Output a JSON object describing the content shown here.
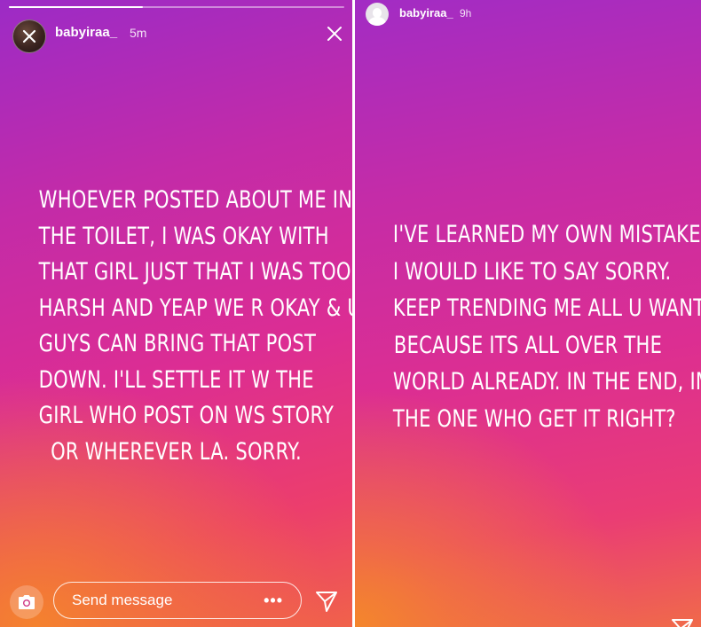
{
  "left_story": {
    "username": "babyiraa_",
    "time": "5m",
    "progress": 0.4,
    "text_lines": [
      "WHOEVER POSTED ABOUT ME IN",
      "THE TOILET, I WAS OKAY WITH",
      "THAT GIRL JUST THAT I WAS TOO",
      "HARSH AND YEAP WE R OKAY & U",
      "GUYS CAN BRING THAT POST",
      "DOWN. I'LL SETTLE IT W THE",
      "GIRL WHO POST ON WS STORY",
      "OR WHEREVER LA. SORRY."
    ],
    "message_placeholder": "Send message",
    "more_label": "•••"
  },
  "right_story": {
    "username": "babyiraa_",
    "time": "9h",
    "text_lines": [
      "I'VE LEARNED MY OWN MISTAKES,",
      "I WOULD LIKE TO SAY SORRY.",
      "KEEP TRENDING ME ALL U WANT",
      "BECAUSE ITS ALL OVER THE",
      "WORLD ALREADY. IN THE END, IM",
      "THE ONE WHO GET IT RIGHT?"
    ]
  },
  "colors": {
    "gradient_purple": "#9c2bc6",
    "gradient_magenta": "#dc2d93",
    "gradient_orange": "#f4822e",
    "text": "#ffffff"
  },
  "icons": {
    "close": "close-icon",
    "camera": "camera-icon",
    "send": "send-icon",
    "more": "more-dots-icon"
  }
}
